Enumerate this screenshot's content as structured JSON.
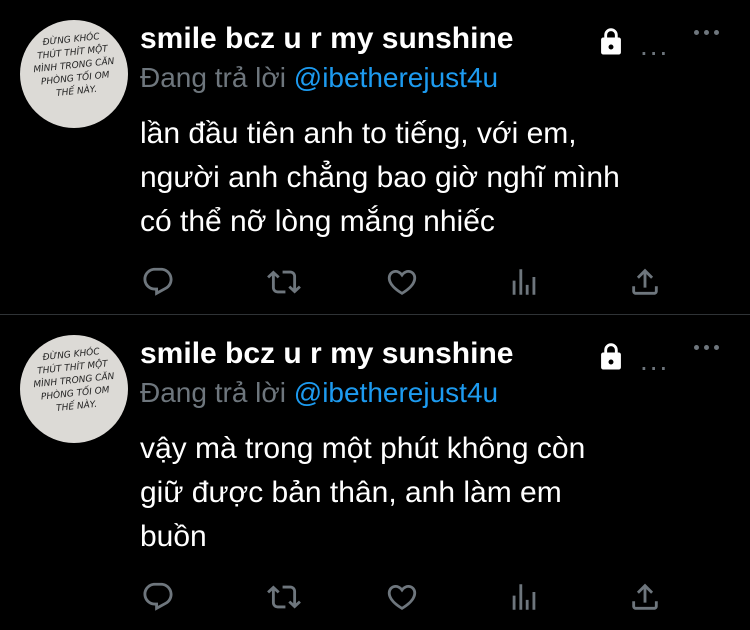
{
  "tweets": [
    {
      "author_name": "smile bcz u r my sunshine",
      "protected_icon": "lock-icon",
      "truncation": "...",
      "more_icon": "more-horizontal-icon",
      "reply_prefix": "Đang trả lời",
      "reply_handle": "@ibetherejust4u",
      "avatar_text": [
        "ĐỪNG KHÓC",
        "THÚT THÍT MỘT",
        "MÌNH TRONG CĂN",
        "PHÒNG TỐI OM",
        "THẾ NÀY."
      ],
      "body_lines": [
        "lần đầu tiên anh to tiếng, với em,",
        "người anh chẳng bao giờ nghĩ mình",
        "có thể nỡ lòng mắng nhiếc"
      ],
      "actions": [
        "reply-icon",
        "retweet-icon",
        "like-icon",
        "analytics-icon",
        "share-icon"
      ]
    },
    {
      "author_name": "smile bcz u r my sunshine",
      "protected_icon": "lock-icon",
      "truncation": "...",
      "more_icon": "more-horizontal-icon",
      "reply_prefix": "Đang trả lời",
      "reply_handle": "@ibetherejust4u",
      "avatar_text": [
        "ĐỪNG KHÓC",
        "THÚT THÍT MỘT",
        "MÌNH TRONG CĂN",
        "PHÒNG TỐI OM",
        "THẾ NÀY."
      ],
      "body_lines": [
        "vậy mà trong một phút không còn",
        "giữ được bản thân, anh làm em",
        "buồn"
      ],
      "actions": [
        "reply-icon",
        "retweet-icon",
        "like-icon",
        "analytics-icon",
        "share-icon"
      ]
    }
  ],
  "colors": {
    "background": "#000000",
    "text": "#ffffff",
    "secondary": "#6e767d",
    "link": "#1d9bf0",
    "divider": "#2f3336"
  }
}
